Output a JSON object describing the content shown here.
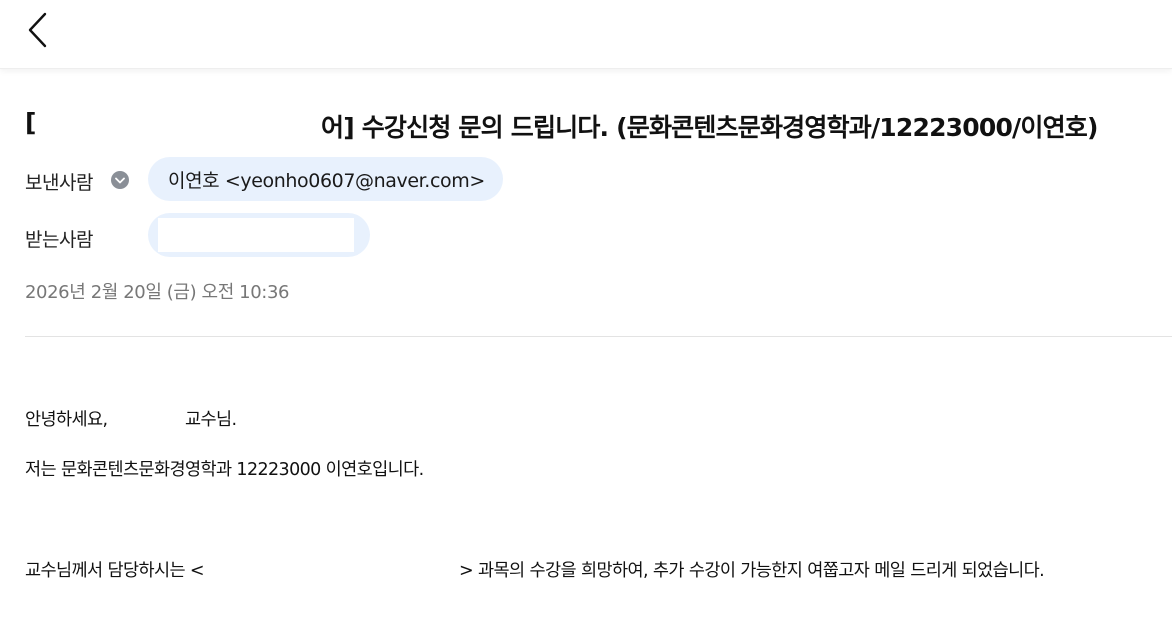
{
  "header": {
    "back_icon": "chevron-left-icon"
  },
  "email": {
    "subject_start": "[",
    "subject_visible": "어] 수강신청 문의 드립니다. (문화콘텐츠문화경영학과/12223000/이연호)",
    "sender_label": "보낸사람",
    "sender_toggle_icon": "chevron-down-circle-icon",
    "sender": "이연호 <yeonho0607@naver.com>",
    "recipient_label": "받는사람",
    "date": "2026년 2월 20일 (금) 오전 10:36",
    "body": {
      "greeting_a": "안녕하세요,",
      "greeting_b": "교수님.",
      "intro": "저는 문화콘텐츠문화경영학과 12223000 이연호입니다.",
      "request_a": "교수님께서 담당하시는 <",
      "request_b": "> 과목의 수강을 희망하여, 추가 수강이 가능한지 여쭙고자 메일 드리게 되었습니다."
    }
  },
  "colors": {
    "chip_bg": "#e8f1fd",
    "muted_text": "#777777",
    "divider": "#e3e3e3"
  }
}
